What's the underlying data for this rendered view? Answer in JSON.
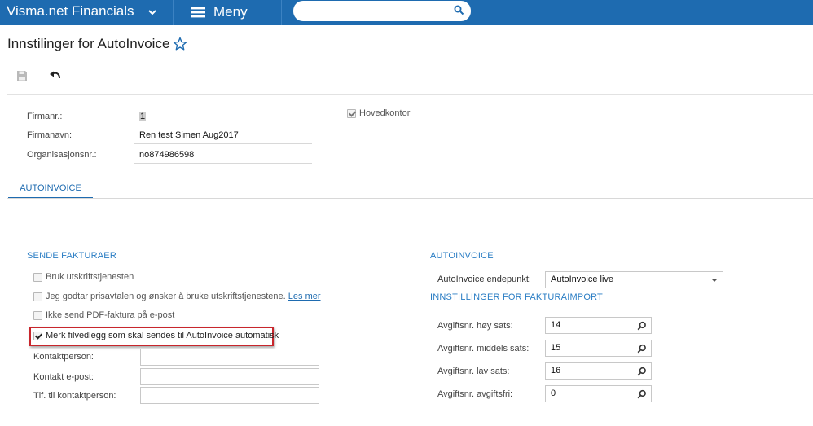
{
  "topbar": {
    "app_title": "Visma.net Financials",
    "menu_label": "Meny",
    "search_placeholder": ""
  },
  "page": {
    "title": "Innstilinger for AutoInvoice"
  },
  "header_form": {
    "company_no_label": "Firmanr.:",
    "company_no_value": "1",
    "company_name_label": "Firmanavn:",
    "company_name_value": "Ren test Simen Aug2017",
    "org_no_label": "Organisasjonsnr.:",
    "org_no_value": "no874986598",
    "head_office_label": "Hovedkontor",
    "head_office_checked": true
  },
  "tabs": [
    {
      "label": "AUTOINVOICE",
      "active": true
    }
  ],
  "send_invoices": {
    "heading": "SENDE FAKTURAER",
    "options": [
      {
        "label": "Bruk utskriftstjenesten",
        "checked": false
      },
      {
        "label": "Jeg godtar prisavtalen og ønsker å bruke utskriftstjenestene.",
        "link": "Les mer",
        "checked": false
      },
      {
        "label": "Ikke send PDF-faktura på e-post",
        "checked": false
      },
      {
        "label": "Merk filvedlegg som skal sendes til AutoInvoice automatisk",
        "checked": true
      }
    ],
    "contact_person_label": "Kontaktperson:",
    "contact_person_value": "",
    "contact_email_label": "Kontakt e-post:",
    "contact_email_value": "",
    "contact_phone_label": "Tlf. til kontaktperson:",
    "contact_phone_value": ""
  },
  "autoinvoice": {
    "heading": "AUTOINVOICE",
    "endpoint_label": "AutoInvoice endepunkt:",
    "endpoint_value": "AutoInvoice live"
  },
  "invoice_import": {
    "heading": "INNSTILLINGER FOR FAKTURAIMPORT",
    "fields": [
      {
        "label": "Avgiftsnr. høy sats:",
        "value": "14"
      },
      {
        "label": "Avgiftsnr. middels sats:",
        "value": "15"
      },
      {
        "label": "Avgiftsnr. lav sats:",
        "value": "16"
      },
      {
        "label": "Avgiftsnr. avgiftsfri:",
        "value": "0"
      }
    ]
  },
  "colors": {
    "brand": "#1e6bb0",
    "section_heading": "#2a7dc4",
    "highlight_border": "#c8262c"
  },
  "icons": [
    "chevron-down-icon",
    "hamburger-icon",
    "search-icon",
    "star-icon",
    "save-icon",
    "undo-icon",
    "lookup-icon"
  ]
}
